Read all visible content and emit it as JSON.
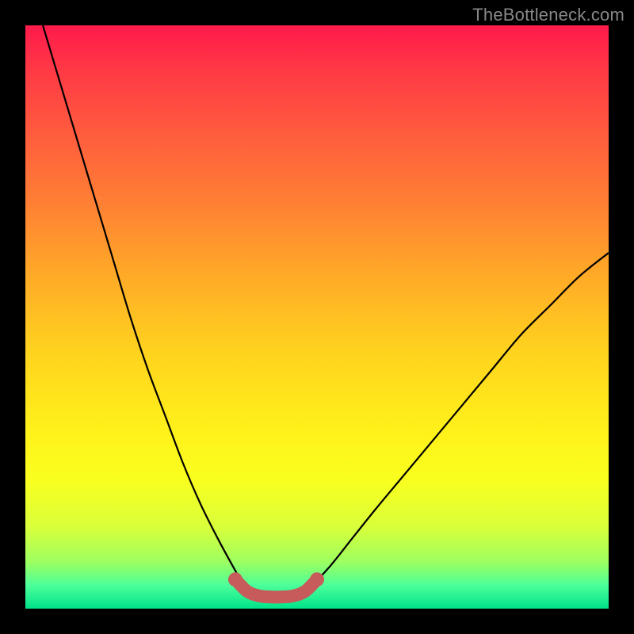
{
  "watermark": "TheBottleneck.com",
  "colors": {
    "frame": "#000000",
    "curve_stroke": "#000000",
    "marker_fill": "#c75a5a",
    "marker_stroke": "#c75a5a",
    "gradient_stops": [
      "#ff1a4b",
      "#ff3a45",
      "#ff5a3e",
      "#ff7e34",
      "#ffa728",
      "#ffd31e",
      "#fff21a",
      "#f9ff1f",
      "#d9ff3a",
      "#9dff60",
      "#4cff9a",
      "#00e38a"
    ]
  },
  "chart_data": {
    "type": "line",
    "title": "",
    "xlabel": "",
    "ylabel": "",
    "xlim": [
      0,
      100
    ],
    "ylim": [
      0,
      100
    ],
    "series": [
      {
        "name": "bottleneck-curve-left",
        "x": [
          3,
          6,
          9,
          12,
          15,
          18,
          21,
          24,
          27,
          30,
          33,
          36,
          38
        ],
        "y": [
          100,
          90,
          80,
          70,
          60,
          50,
          41,
          33,
          25,
          18,
          12,
          6.5,
          3
        ]
      },
      {
        "name": "bottleneck-curve-flat",
        "x": [
          38,
          40,
          42,
          44,
          46,
          48
        ],
        "y": [
          3,
          2.2,
          2,
          2,
          2.2,
          3
        ]
      },
      {
        "name": "bottleneck-curve-right",
        "x": [
          48,
          52,
          56,
          60,
          65,
          70,
          75,
          80,
          85,
          90,
          95,
          100
        ],
        "y": [
          3,
          7,
          12,
          17,
          23,
          29,
          35,
          41,
          47,
          52,
          57,
          61
        ]
      }
    ],
    "highlighted_region": {
      "name": "optimal-range",
      "x": [
        36,
        38,
        40,
        42,
        44,
        46,
        48,
        50
      ],
      "y": [
        5,
        3,
        2.2,
        2,
        2,
        2.2,
        3,
        5
      ]
    }
  }
}
